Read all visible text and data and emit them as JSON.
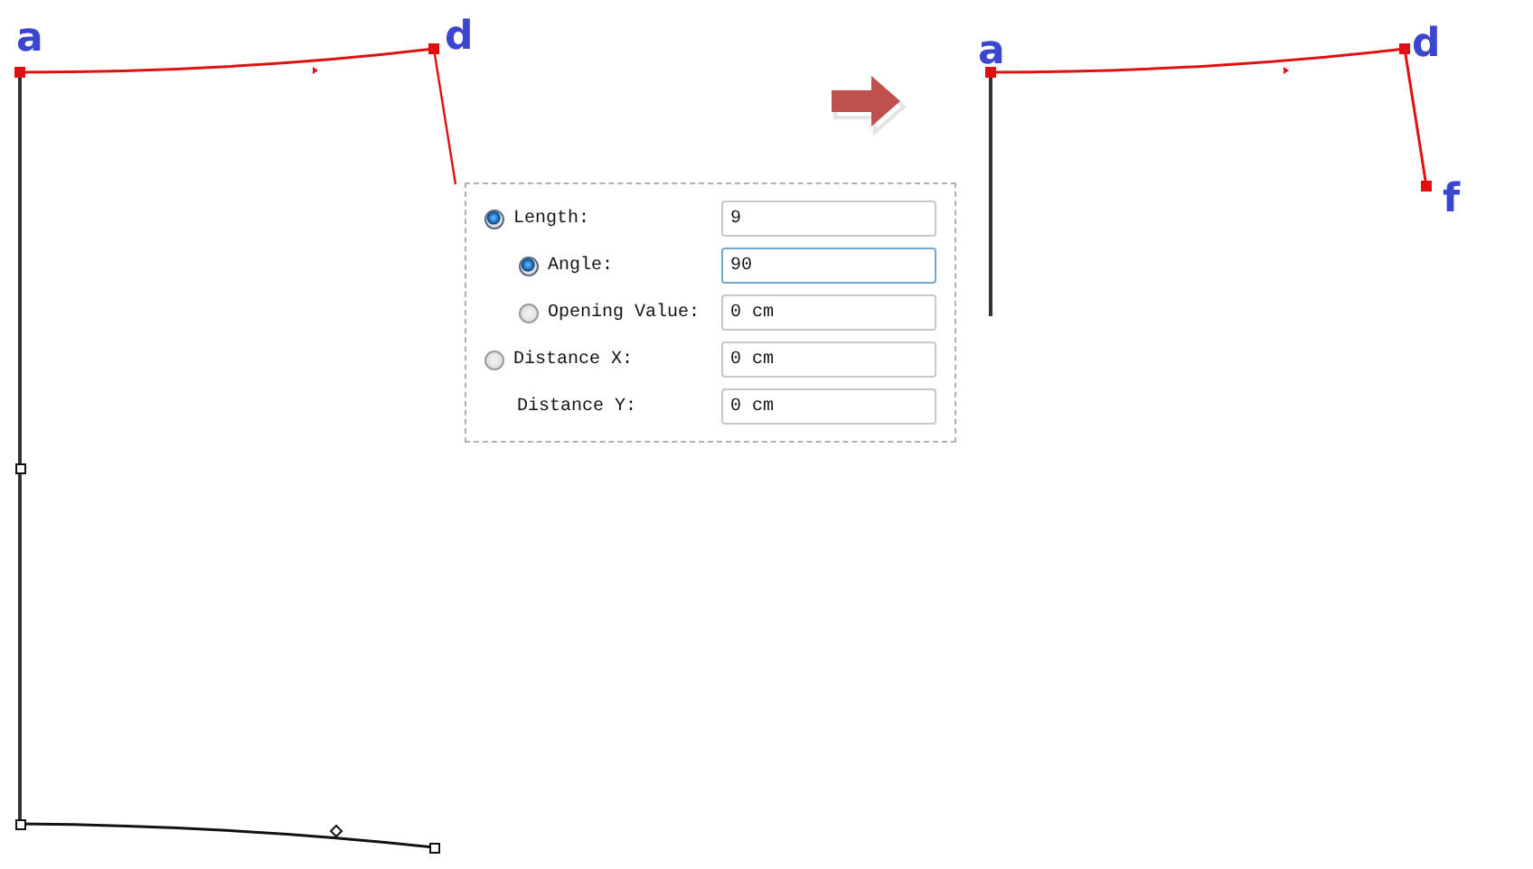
{
  "left_figure": {
    "labels": [
      "a",
      "d"
    ]
  },
  "right_figure": {
    "labels": [
      "a",
      "d",
      "f"
    ]
  },
  "dialog": {
    "rows": [
      {
        "kind": "radio",
        "label": "Length:",
        "selected": true,
        "value": "9",
        "focused": false,
        "children": [
          {
            "kind": "radio",
            "label": "Angle:",
            "selected": true,
            "value": "90",
            "focused": true
          },
          {
            "kind": "radio",
            "label": "Opening Value:",
            "selected": false,
            "value": "0 cm",
            "focused": false
          }
        ]
      },
      {
        "kind": "radio",
        "label": "Distance X:",
        "selected": false,
        "value": "0 cm",
        "focused": false
      },
      {
        "kind": "plain",
        "label": "Distance Y:",
        "value": "0 cm",
        "focused": false
      }
    ]
  }
}
